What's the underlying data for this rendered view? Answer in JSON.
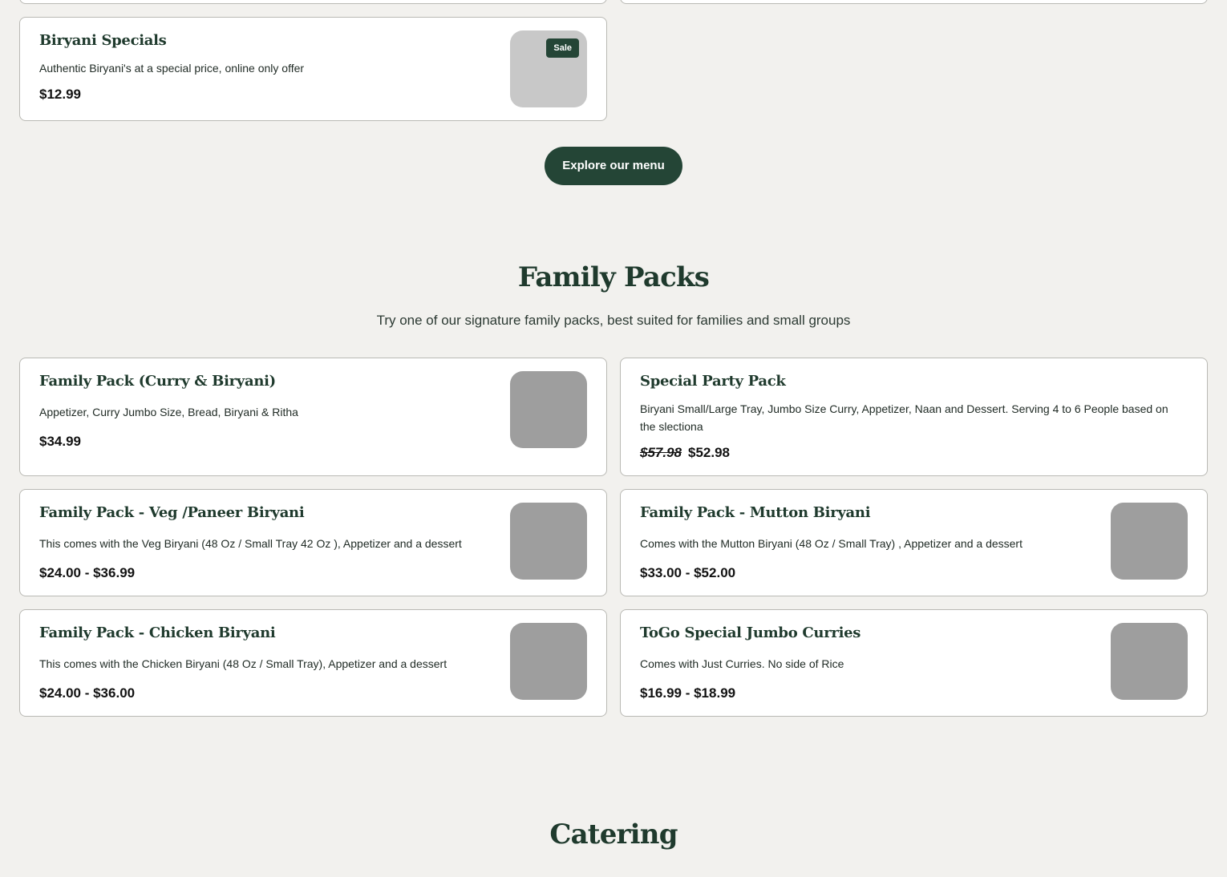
{
  "colors": {
    "brand_green": "#244536",
    "page_bg": "#f2f1ee",
    "thumb_gray": "#9e9e9e"
  },
  "top_section": {
    "biryani_specials": {
      "title": "Biryani Specials",
      "description": "Authentic Biryani's at a special price, online only offer",
      "price": "$12.99",
      "badge": "Sale"
    },
    "explore_button": "Explore our menu"
  },
  "family_packs": {
    "title": "Family Packs",
    "subtitle": "Try one of our signature family packs, best suited for families and small groups",
    "items": [
      {
        "title": "Family Pack (Curry & Biryani)",
        "description": "Appetizer, Curry Jumbo Size, Bread, Biryani & Ritha",
        "price": "$34.99"
      },
      {
        "title": "Special Party Pack",
        "description": "Biryani Small/Large Tray, Jumbo Size Curry, Appetizer, Naan and Dessert. Serving 4 to 6 People based on the slectiona",
        "price_old": "$57.98",
        "price": "$52.98"
      },
      {
        "title": "Family Pack - Veg /Paneer Biryani",
        "description": "This comes with the Veg Biryani (48 Oz / Small Tray 42 Oz ), Appetizer and a dessert",
        "price": "$24.00 - $36.99"
      },
      {
        "title": "Family Pack - Mutton Biryani",
        "description": "Comes with the Mutton Biryani (48 Oz / Small Tray) , Appetizer and a dessert",
        "price": "$33.00 - $52.00"
      },
      {
        "title": "Family Pack - Chicken Biryani",
        "description": "This comes with the Chicken Biryani (48 Oz / Small Tray), Appetizer and a dessert",
        "price": "$24.00 - $36.00"
      },
      {
        "title": "ToGo Special Jumbo Curries",
        "description": "Comes with Just Curries. No side of Rice",
        "price": "$16.99 - $18.99"
      }
    ]
  },
  "catering": {
    "title": "Catering"
  }
}
